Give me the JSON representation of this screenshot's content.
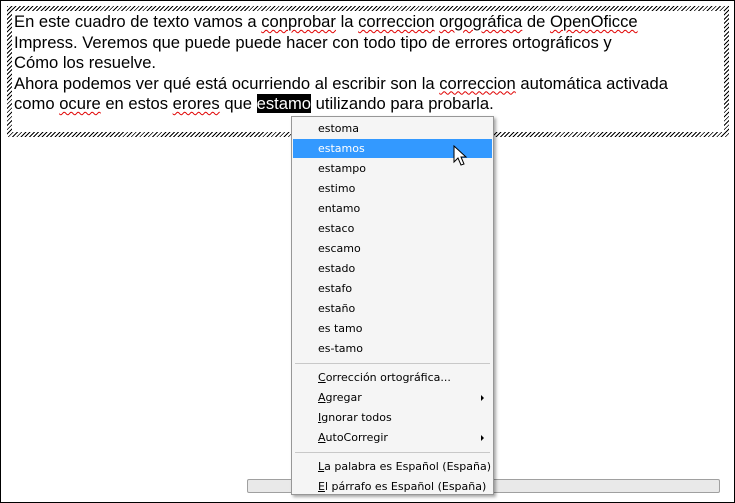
{
  "document": {
    "lines": [
      [
        {
          "t": "En este cuadro de texto vamos a "
        },
        {
          "t": "conprobar",
          "err": true
        },
        {
          "t": " la "
        },
        {
          "t": "correccion",
          "err": true
        },
        {
          "t": " "
        },
        {
          "t": "orgográfica",
          "err": true
        },
        {
          "t": " de "
        },
        {
          "t": "OpenOficce",
          "err": true
        }
      ],
      [
        {
          "t": "Impress. Veremos que puede puede hacer con todo tipo de errores ortográficos y"
        }
      ],
      [
        {
          "t": "Cómo los resuelve."
        }
      ],
      [
        {
          "t": "Ahora podemos ver qué está ocurriendo al escribir son la "
        },
        {
          "t": "correccion",
          "err": true
        },
        {
          "t": " automática activada"
        }
      ],
      [
        {
          "t": "como "
        },
        {
          "t": "ocure",
          "err": true
        },
        {
          "t": " en estos "
        },
        {
          "t": "erores",
          "err": true
        },
        {
          "t": " que "
        },
        {
          "t": "estamo",
          "sel": true
        },
        {
          "t": " utilizando para probarla."
        }
      ]
    ]
  },
  "context_menu": {
    "suggestions": [
      "estoma",
      "estamos",
      "estampo",
      "estimo",
      "entamo",
      "estaco",
      "escamo",
      "estado",
      "estafo",
      "estaño",
      "es tamo",
      "es-tamo"
    ],
    "highlighted_index": 1,
    "actions": [
      {
        "pre": "",
        "acc": "C",
        "post": "orrección ortográfica...",
        "submenu": false
      },
      {
        "pre": "",
        "acc": "A",
        "post": "gregar",
        "submenu": true
      },
      {
        "pre": "",
        "acc": "I",
        "post": "gnorar todos",
        "submenu": false
      },
      {
        "pre": "",
        "acc": "A",
        "post": "utoCorregir",
        "submenu": true
      }
    ],
    "language_items": [
      {
        "pre": "",
        "acc": "L",
        "post": "a palabra es Español (España)"
      },
      {
        "pre": "",
        "acc": "E",
        "post": "l párrafo es Español (España)"
      }
    ],
    "colors": {
      "highlight": "#3399ff",
      "background": "#f5f5f5"
    }
  },
  "icons": {
    "cursor": "arrow-pointer-icon",
    "submenu": "chevron-right-icon"
  }
}
